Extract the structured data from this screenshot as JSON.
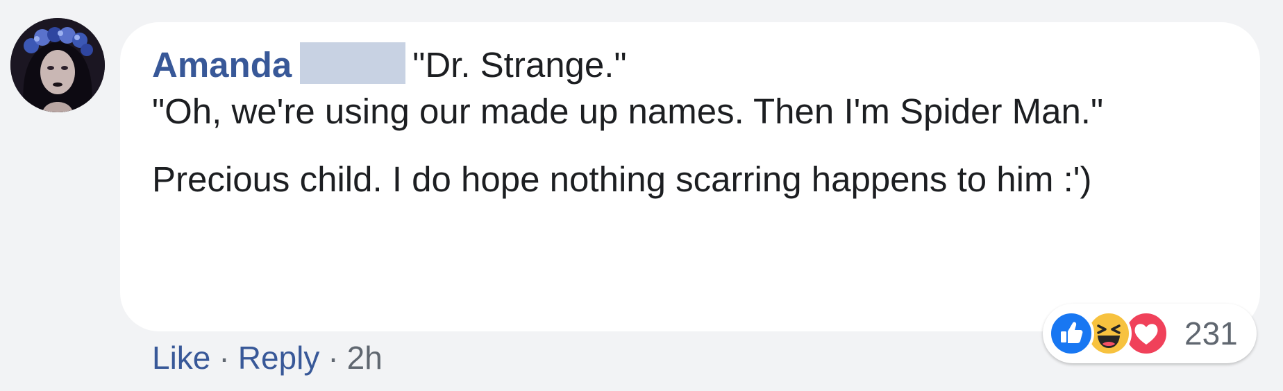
{
  "comment": {
    "author": "Amanda",
    "paragraphs": [
      "\"Dr. Strange.\"\n\"Oh, we're using our made up names. Then I'm Spider Man.\"",
      "Precious child. I do hope nothing scarring happens to him :')"
    ],
    "quote_first": "\"Dr. Strange.\"",
    "quote_second": "\"Oh, we're using our made up names. Then I'm Spider Man.\"",
    "closing": "Precious child. I do hope nothing scarring happens to him :')"
  },
  "actions": {
    "like_label": "Like",
    "reply_label": "Reply",
    "separator": "·",
    "timestamp": "2h"
  },
  "reactions": {
    "types": [
      "like-icon",
      "haha-icon",
      "love-icon"
    ],
    "count": "231"
  },
  "colors": {
    "author": "#385898",
    "link": "#385898",
    "meta": "#606770",
    "text": "#1c1e21",
    "background": "#f2f3f5",
    "bubble": "#ffffff",
    "redaction": "#c8d2e3",
    "like": "#1877f2",
    "haha": "#f7c23f",
    "love": "#f0415a"
  }
}
